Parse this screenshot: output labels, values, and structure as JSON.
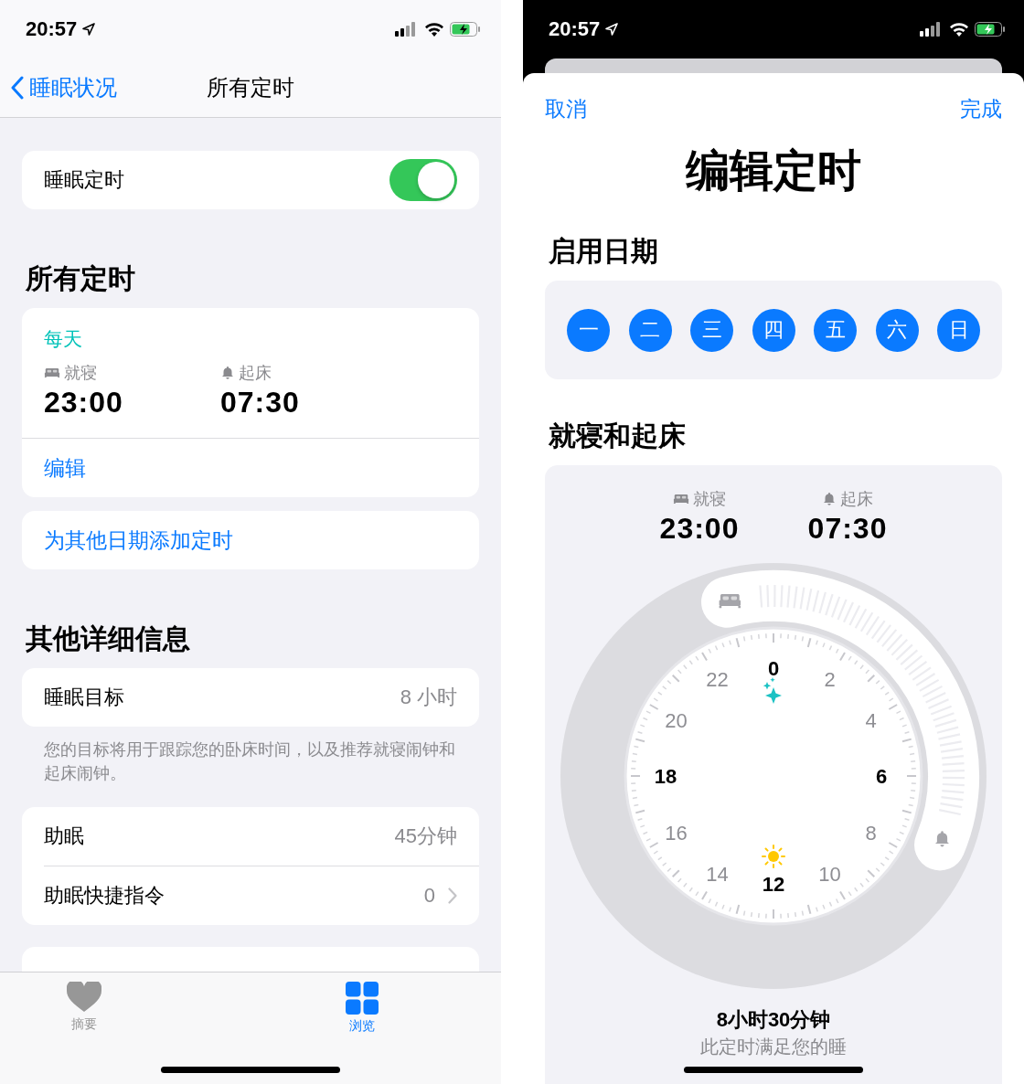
{
  "left": {
    "status_bar": {
      "time": "20:57"
    },
    "nav": {
      "back": "睡眠状况",
      "title": "所有定时"
    },
    "sleep_schedule": {
      "label": "睡眠定时",
      "on": true
    },
    "schedules_header": "所有定时",
    "schedule": {
      "repeat": "每天",
      "bedtime_label": "就寝",
      "bedtime": "23:00",
      "wake_label": "起床",
      "wake": "07:30",
      "edit": "编辑"
    },
    "add_schedule": "为其他日期添加定时",
    "details_header": "其他详细信息",
    "sleep_goal": {
      "label": "睡眠目标",
      "value": "8 小时"
    },
    "goal_note": "您的目标将用于跟踪您的卧床时间，以及推荐就寝闹钟和起床闹钟。",
    "wind_down": [
      {
        "label": "助眠",
        "value": "45分钟",
        "chevron": false
      },
      {
        "label": "助眠快捷指令",
        "value": "0",
        "chevron": true
      }
    ],
    "tabs": [
      {
        "label": "摘要",
        "selected": false,
        "kind": "heart"
      },
      {
        "label": "浏览",
        "selected": true,
        "kind": "grid"
      }
    ]
  },
  "right": {
    "status_bar": {
      "time": "20:57"
    },
    "cancel": "取消",
    "done": "完成",
    "title": "编辑定时",
    "days_header": "启用日期",
    "days": [
      {
        "label": "一",
        "selected": true
      },
      {
        "label": "二",
        "selected": true
      },
      {
        "label": "三",
        "selected": true
      },
      {
        "label": "四",
        "selected": true
      },
      {
        "label": "五",
        "selected": true
      },
      {
        "label": "六",
        "selected": true
      },
      {
        "label": "日",
        "selected": true
      }
    ],
    "bed_wake_header": "就寝和起床",
    "bedtime_label": "就寝",
    "bedtime": "23:00",
    "wake_label": "起床",
    "wake": "07:30",
    "dial_hours": [
      "0",
      "2",
      "4",
      "6",
      "8",
      "10",
      "12",
      "14",
      "16",
      "18",
      "20",
      "22"
    ],
    "duration": "8小时30分钟",
    "note": "此定时满足您的睡"
  }
}
